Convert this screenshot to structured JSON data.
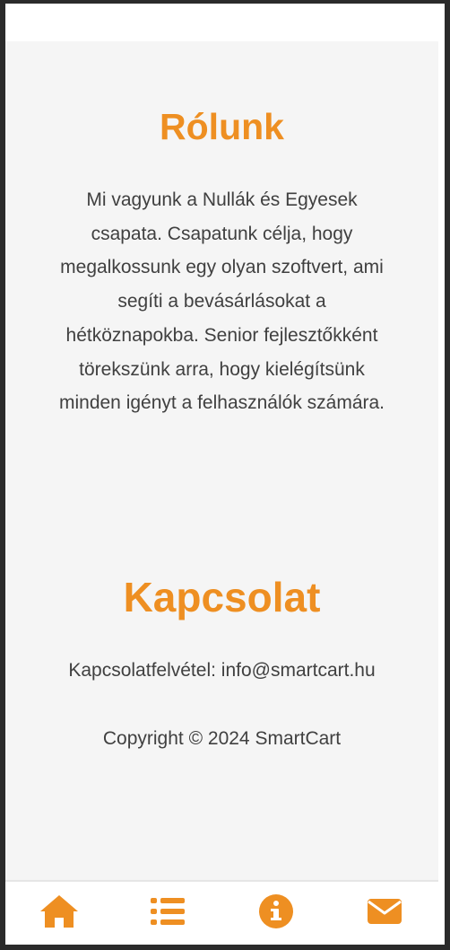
{
  "about": {
    "title": "Rólunk",
    "text": "Mi vagyunk a Nullák és Egyesek csapata. Csapatunk célja, hogy megalkossunk egy olyan szoftvert, ami segíti a bevásárlásokat a hétköznapokba. Senior fejlesztőkként törekszünk arra, hogy kielégítsünk minden igényt a felhasználók számára."
  },
  "contact": {
    "title": "Kapcsolat",
    "email_line": "Kapcsolatfelvétel: info@smartcart.hu",
    "copyright": "Copyright © 2024 SmartCart"
  },
  "nav": {
    "items": [
      {
        "icon": "home-icon"
      },
      {
        "icon": "list-icon"
      },
      {
        "icon": "info-icon"
      },
      {
        "icon": "envelope-icon"
      }
    ],
    "accent_color": "#ee8f22"
  }
}
